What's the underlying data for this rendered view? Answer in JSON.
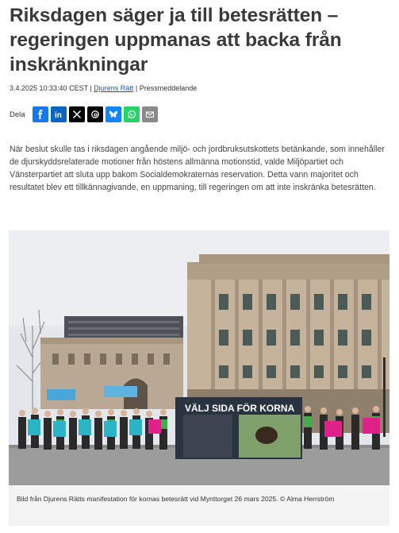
{
  "article": {
    "title": "Riksdagen säger ja till betesrätten – regeringen uppmanas att backa från inskränkningar",
    "date": "3.4.2025 10:33:40 CEST",
    "separator": "|",
    "source": "Djurens Rätt",
    "type": "Pressmeddelande",
    "body": "När beslut skulle tas i riksdagen angående miljö- och jordbruksutskottets betänkande, som innehåller de djurskyddsrelaterade motioner från höstens allmänna motionstid, valde Miljöpartiet och Vänsterpartiet att sluta upp bakom Socialdemokraternas reservation. Detta vann majoritet och resultatet blev ett tillkännagivande, en uppmaning, till regeringen om att inte inskränka betesrätten.",
    "caption": "Bild från Djurens Rätts manifestation för kornas betesrätt vid Mynttorget 26 mars 2025. © Alma Herrström"
  },
  "share": {
    "label": "Dela",
    "buttons": [
      {
        "icon": "facebook-icon",
        "color": "#1877f2"
      },
      {
        "icon": "linkedin-icon",
        "color": "#0a66c2"
      },
      {
        "icon": "x-icon",
        "color": "#000000"
      },
      {
        "icon": "threads-icon",
        "color": "#000000"
      },
      {
        "icon": "bluesky-icon",
        "color": "#1185fe"
      },
      {
        "icon": "whatsapp-icon",
        "color": "#25d366"
      },
      {
        "icon": "email-icon",
        "color": "#8a8a8a"
      }
    ]
  },
  "photo": {
    "banner_text": "VÄLJ SIDA FÖR KORNA"
  },
  "colors": {
    "title": "#3a3a3a",
    "link": "#1a56b8",
    "caption_bg": "#f3f3f3"
  }
}
